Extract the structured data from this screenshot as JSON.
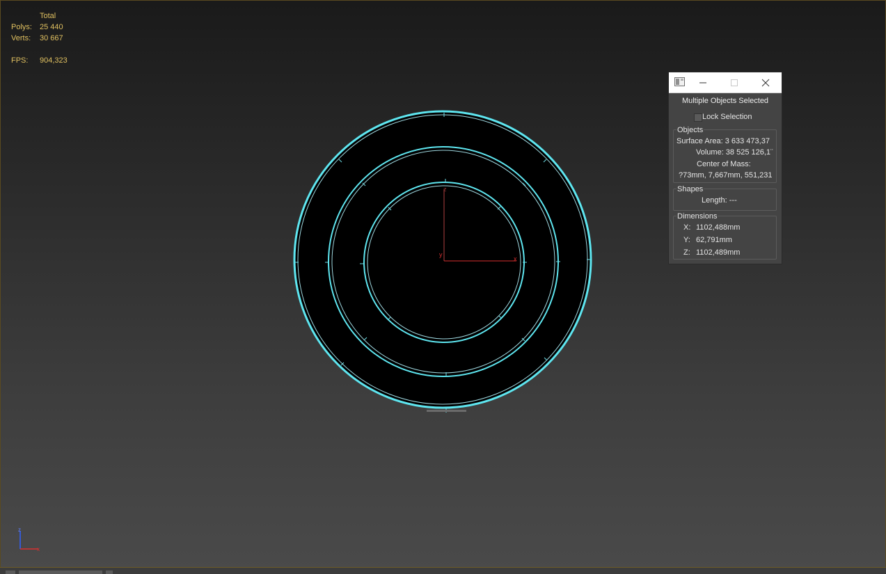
{
  "stats": {
    "header": "Total",
    "polys_label": "Polys:",
    "polys_value": "25 440",
    "verts_label": "Verts:",
    "verts_value": "30 667",
    "fps_label": "FPS:",
    "fps_value": "904,323"
  },
  "scene": {
    "axis_x": "x",
    "axis_y": "y",
    "axis_z": "z"
  },
  "gizmo": {
    "axis_x": "x",
    "axis_z": "z"
  },
  "measure": {
    "heading": "Multiple Objects Selected",
    "lock_label": "Lock Selection",
    "lock_checked": false,
    "objects_title": "Objects",
    "surface_area": "Surface Area:  3 633 473,37",
    "volume": "Volume:  38 525 126,1¨",
    "center_label": "Center of Mass:",
    "center_value": "?73mm, 7,667mm, 551,231",
    "shapes_title": "Shapes",
    "length": "Length:  ---",
    "dims_title": "Dimensions",
    "dim_x_label": "X:",
    "dim_x_value": "1102,488mm",
    "dim_y_label": "Y:",
    "dim_y_value": "62,791mm",
    "dim_z_label": "Z:",
    "dim_z_value": "1102,489mm"
  },
  "colors": {
    "stats_text": "#e0c060",
    "selection_outline": "#5ee6f0",
    "axis_red": "#d83030",
    "axis_blue": "#3060ff"
  }
}
